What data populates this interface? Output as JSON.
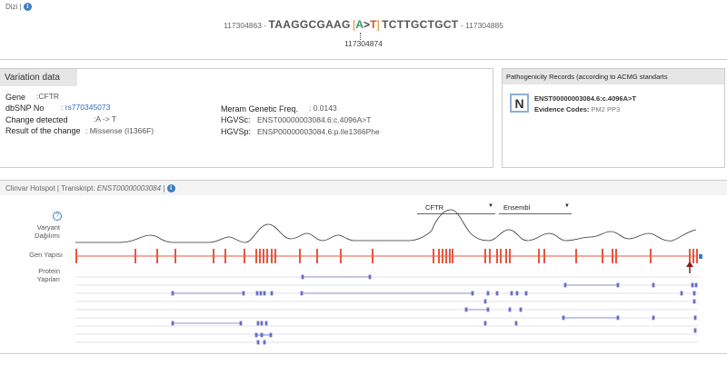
{
  "dizi": {
    "title": "Dizi |",
    "pos_left": "117304863 -",
    "seq_left": "TAAGGCGAAG",
    "bracket_open": "[",
    "ref": "A",
    "arrow": ">",
    "alt": "T",
    "bracket_close": "]",
    "seq_right": "TCTTGCTGCT",
    "pos_right": "- 117304885",
    "position": "117304874"
  },
  "variation": {
    "title": "Variation data",
    "gene_label": "Gene",
    "gene_value": ":CFTR",
    "dbsnp_label": "dbSNP No",
    "dbsnp_value": ": rs770345073",
    "change_label": "Change detected",
    "change_value": ":A -> T",
    "result_label": "Result of the change",
    "result_value": ": Missense (I1366F)",
    "meram_label": "Meram Genetic Freq.",
    "meram_value": ": 0.0143",
    "hgvsc_label": "HGVSc:",
    "hgvsc_value": "ENST00000003084.6:c.4096A>T",
    "hgvsp_label": "HGVSp:",
    "hgvsp_value": "ENSP00000003084.6:p.Ile1366Phe"
  },
  "pathogenicity": {
    "title": "Pathogenicity Records (according to ACMG standarts",
    "badge": "N",
    "transcript": "ENST00000003084.6:c.4096A>T",
    "evidence_label": "Evidence Codes:",
    "evidence_value": "PM2 PP3"
  },
  "clinvar": {
    "title_prefix": "Clinvar Hotspot | Transkript:",
    "transcript": "ENST00000003084",
    "title_suffix": "|",
    "help": "?",
    "varyant_label_1": "Varyant",
    "varyant_label_2": "Dağılımı",
    "gen_label": "Gen Yapısı",
    "protein_label_1": "Protein",
    "protein_label_2": "Yapıları",
    "gene_select": "CFTR",
    "source_select": "Ensembl"
  },
  "colors": {
    "exon": "#e8563f",
    "protein": "#6b6fc4",
    "accent": "#3d7fc1",
    "marker": "#8b1a1a"
  }
}
